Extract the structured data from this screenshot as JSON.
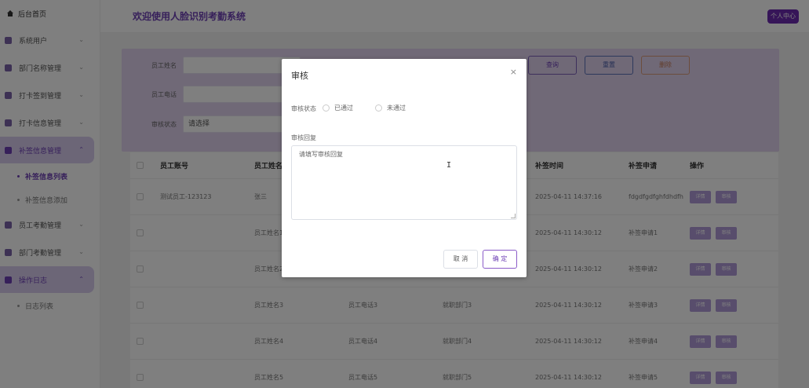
{
  "sidebar": {
    "home": "后台首页",
    "items": [
      {
        "label": "系统用户"
      },
      {
        "label": "部门名称管理"
      },
      {
        "label": "打卡签到管理"
      },
      {
        "label": "打卡信息管理"
      },
      {
        "label": "补签信息管理",
        "subs": [
          "补签信息列表",
          "补签信息添加"
        ]
      },
      {
        "label": "员工考勤管理"
      },
      {
        "label": "部门考勤管理"
      },
      {
        "label": "操作日志",
        "subs": [
          "日志列表"
        ]
      }
    ]
  },
  "header": {
    "title": "欢迎使用人脸识别考勤系统",
    "profile": "个人中心"
  },
  "search": {
    "name_label": "员工姓名",
    "phone_label": "员工电话",
    "status_label": "审核状态",
    "status_value": "请选择",
    "query": "查询",
    "reset": "重置",
    "delete": "删除"
  },
  "table": {
    "headers": [
      "员工账号",
      "员工姓名",
      "",
      "",
      "补签时间",
      "补签申请",
      "操作"
    ],
    "rows": [
      [
        "测试员工-123123",
        "张三",
        "",
        "",
        "2025-04-11 14:37:16",
        "fdgdfgdfghfdhdfh"
      ],
      [
        "",
        "员工姓名1",
        "",
        "",
        "2025-04-11 14:30:12",
        "补签申请1"
      ],
      [
        "",
        "员工姓名2",
        "",
        "",
        "2025-04-11 14:30:12",
        "补签申请2"
      ],
      [
        "",
        "员工姓名3",
        "员工电话3",
        "就职部门3",
        "2025-04-11 14:30:12",
        "补签申请3"
      ],
      [
        "",
        "员工姓名4",
        "员工电话4",
        "就职部门4",
        "2025-04-11 14:30:12",
        "补签申请4"
      ],
      [
        "",
        "员工姓名5",
        "员工电话5",
        "就职部门5",
        "2025-04-11 14:30:12",
        "补签申请5"
      ]
    ],
    "detail_btn": "详情",
    "audit_btn": "审核"
  },
  "dialog": {
    "title": "审核",
    "close": "×",
    "status_label": "审核状态",
    "opt_pass": "已通过",
    "opt_fail": "未通过",
    "reply_label": "审核回复",
    "reply_placeholder": "请填写审核回复",
    "cancel": "取 消",
    "confirm": "确 定"
  },
  "colors": {
    "accent": "#6d3fb5",
    "panel": "#e0d2ef",
    "btn_fill": "#b09bd9"
  }
}
